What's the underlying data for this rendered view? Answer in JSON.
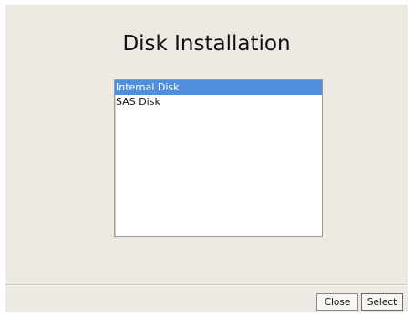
{
  "dialog": {
    "title": "Disk Installation",
    "list": {
      "items": [
        {
          "label": "Internal Disk",
          "selected": true
        },
        {
          "label": "SAS Disk",
          "selected": false
        }
      ]
    },
    "buttons": {
      "close_label": "Close",
      "select_label": "Select"
    }
  },
  "colors": {
    "dialog_background": "#edeae4",
    "selection_highlight": "#4f8fdb",
    "list_background": "#ffffff"
  }
}
